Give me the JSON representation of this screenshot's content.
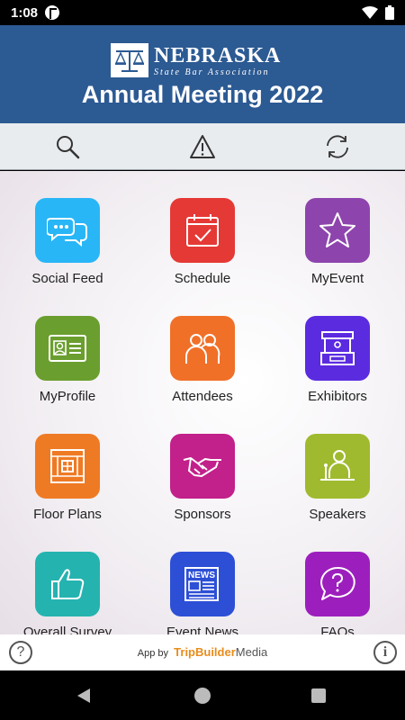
{
  "status_bar": {
    "time": "1:08"
  },
  "header": {
    "org_name": "NEBRASKA",
    "org_subtitle": "State Bar Association",
    "event_title": "Annual Meeting 2022"
  },
  "toolbar": {
    "search_icon": "search-icon",
    "alert_icon": "warning-icon",
    "sync_icon": "refresh-icon"
  },
  "tiles": [
    {
      "label": "Social Feed",
      "color": "#29b6f6",
      "icon": "chat-bubbles-icon"
    },
    {
      "label": "Schedule",
      "color": "#e53935",
      "icon": "calendar-check-icon"
    },
    {
      "label": "MyEvent",
      "color": "#8e44ad",
      "icon": "star-icon"
    },
    {
      "label": "MyProfile",
      "color": "#6a9e2e",
      "icon": "id-card-icon"
    },
    {
      "label": "Attendees",
      "color": "#f07028",
      "icon": "people-icon"
    },
    {
      "label": "Exhibitors",
      "color": "#5b2be0",
      "icon": "booth-icon"
    },
    {
      "label": "Floor Plans",
      "color": "#ef7a24",
      "icon": "floor-plan-icon"
    },
    {
      "label": "Sponsors",
      "color": "#c2208a",
      "icon": "handshake-icon"
    },
    {
      "label": "Speakers",
      "color": "#9fba2e",
      "icon": "speaker-podium-icon"
    },
    {
      "label": "Overall Survey",
      "color": "#25b3b0",
      "icon": "thumbs-up-icon"
    },
    {
      "label": "Event News",
      "color": "#2d4fd6",
      "icon": "newspaper-icon"
    },
    {
      "label": "FAQs",
      "color": "#9c1fbd",
      "icon": "question-bubble-icon"
    }
  ],
  "footer": {
    "app_by": "App by",
    "brand_part1": "TripBuilder",
    "brand_part2": "Media",
    "help_glyph": "?",
    "info_glyph": "i"
  }
}
